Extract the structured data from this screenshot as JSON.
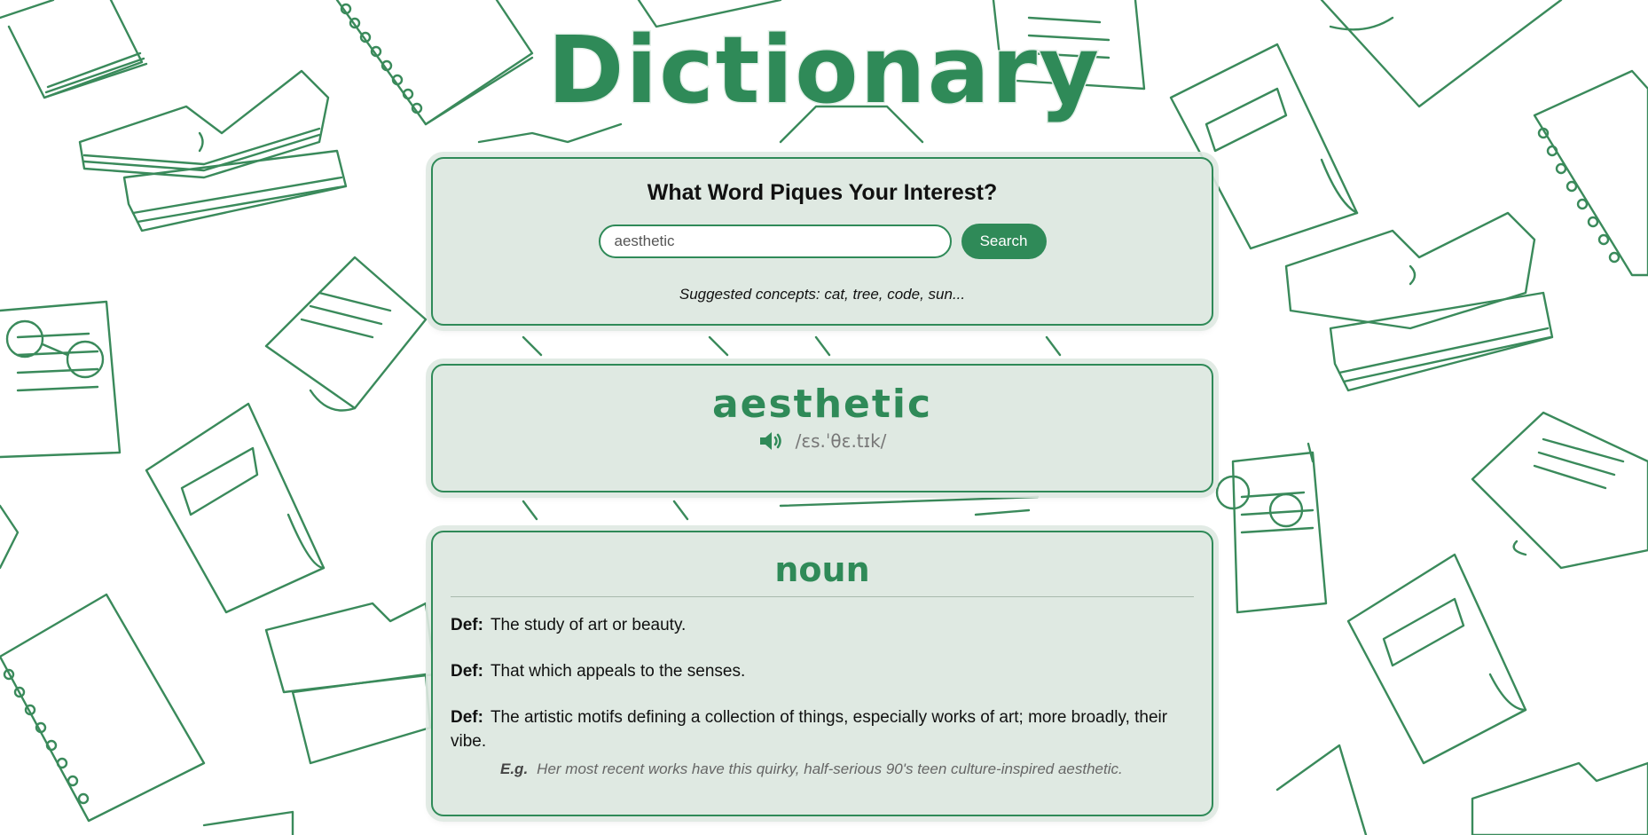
{
  "app": {
    "title": "Dictionary"
  },
  "search": {
    "heading": "What Word Piques Your Interest?",
    "input_value": "aesthetic",
    "button_label": "Search",
    "suggestions": "Suggested concepts: cat, tree, code, sun..."
  },
  "entry": {
    "word": "aesthetic",
    "phonetic": "/ɛs.ˈθɛ.tɪk/",
    "speaker_icon": "speaker-volume-icon"
  },
  "meaning": {
    "part_of_speech": "noun",
    "def_label": "Def:",
    "eg_label": "E.g.",
    "definitions": [
      {
        "text": "The study of art or beauty."
      },
      {
        "text": "That which appeals to the senses."
      },
      {
        "text": "The artistic motifs defining a collection of things, especially works of art; more broadly, their vibe.",
        "example": "Her most recent works have this quirky, half-serious 90's teen culture-inspired aesthetic."
      }
    ]
  },
  "colors": {
    "accent": "#2f8a58",
    "card_bg": "#dfe9e2",
    "doodle": "#3a8a5b"
  }
}
